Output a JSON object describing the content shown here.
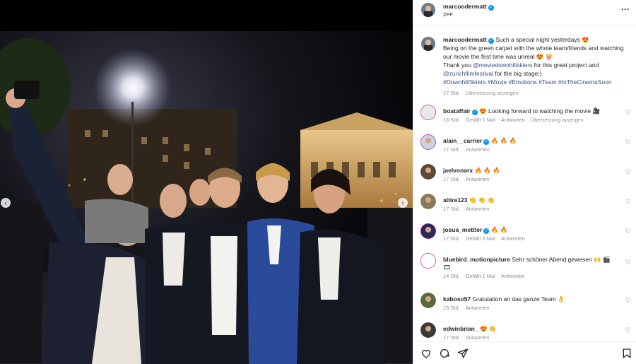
{
  "post": {
    "username": "marcoodermatt",
    "location": "ZFF",
    "caption": {
      "username": "marcoodermatt",
      "line1": "Such a special night yesterdays 😍",
      "line2": "Being on the green carpet with the whole team/friends and watching our movie the first time was unreal 😍 🍿",
      "thank_prefix": "Thank you ",
      "mention1": "@moviedownhillskiers",
      "thank_mid": " for this great project and",
      "mention2": "@zurichfilmfestival",
      "thank_suffix": " for the big stage:)",
      "hashtags": "#DownhillSkiers #Movie #Emotions #Team #InTheCinemaSoon",
      "time": "17 Std.",
      "translate": "Übersetzung anzeigen"
    }
  },
  "comments": [
    {
      "user": "boataffair",
      "verified": true,
      "text": "😍 Looking forward to watching the movie 🎥",
      "time": "16 Std.",
      "likes": "Gefällt 1 Mal",
      "reply": "Antworten",
      "translate": "Übersetzung anzeigen"
    },
    {
      "user": "alain__carrier",
      "verified": true,
      "text": "🔥 🔥 🔥",
      "time": "17 Std.",
      "reply": "Antworten"
    },
    {
      "user": "jaelvonarx",
      "verified": false,
      "text": "🔥 🔥 🔥",
      "time": "17 Std.",
      "reply": "Antworten"
    },
    {
      "user": "altire123",
      "verified": false,
      "text": "👏 👏 👏",
      "time": "17 Std.",
      "reply": "Antworten"
    },
    {
      "user": "josua_mettler",
      "verified": true,
      "text": "🔥 🔥",
      "time": "17 Std.",
      "likes": "Gefällt 5 Mal",
      "reply": "Antworten"
    },
    {
      "user": "bluebird_motionpicture",
      "verified": false,
      "text": "Sehr schöner Abend gewesen 🙌 🎬 🎞",
      "time": "14 Std.",
      "likes": "Gefällt 1 Mal",
      "reply": "Antworten"
    },
    {
      "user": "kaboso57",
      "verified": false,
      "text": "Gratulation an das ganze Team 👌",
      "time": "15 Std.",
      "reply": "Antworten"
    },
    {
      "user": "edwinbrian_",
      "verified": false,
      "text": "😍 👏",
      "time": "17 Std.",
      "reply": "Antworten"
    }
  ],
  "icons": {
    "more": "more-icon",
    "heart": "♡",
    "prev": "‹",
    "next": "›"
  },
  "colors": {
    "link": "#385185",
    "verified": "#0095f6",
    "meta": "#8e8e8e"
  }
}
